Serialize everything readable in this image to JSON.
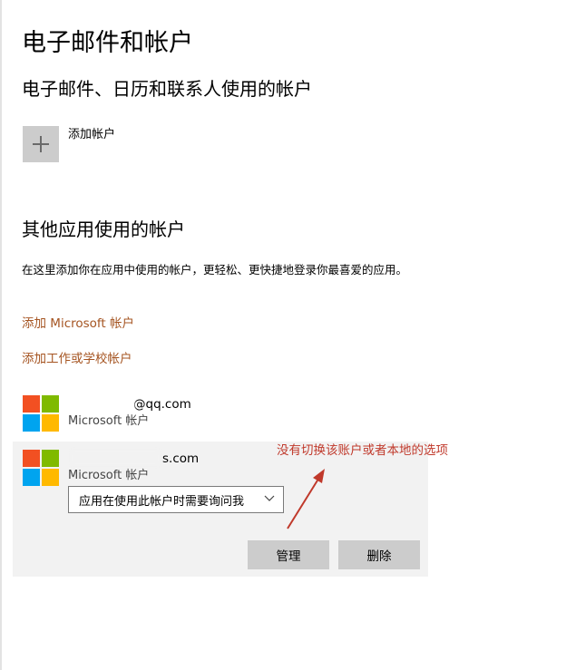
{
  "page": {
    "title": "电子邮件和帐户"
  },
  "email_section": {
    "title": "电子邮件、日历和联系人使用的帐户",
    "add_account_label": "添加帐户"
  },
  "other_apps_section": {
    "title": "其他应用使用的帐户",
    "description": "在这里添加你在应用中使用的帐户，更轻松、更快捷地登录你最喜爱的应用。",
    "add_microsoft_link": "添加 Microsoft 帐户",
    "add_work_link": "添加工作或学校帐户"
  },
  "accounts": [
    {
      "email_visible": "@qq.com",
      "type": "Microsoft 帐户"
    },
    {
      "email_visible": "s.com",
      "type": "Microsoft 帐户",
      "dropdown_value": "应用在使用此帐户时需要询问我",
      "manage_label": "管理",
      "delete_label": "删除"
    }
  ],
  "annotation": {
    "text": "没有切换该账户或者本地的选项",
    "color": "#c0392b"
  },
  "colors": {
    "ms_red": "#f25022",
    "ms_green": "#7fba00",
    "ms_blue": "#00a4ef",
    "ms_yellow": "#ffb900",
    "link": "#a55421",
    "button_bg": "#cccccc",
    "expanded_bg": "#f2f2f2"
  },
  "icons": {
    "add": "plus-icon",
    "account_logo": "microsoft-logo-icon",
    "dropdown": "chevron-down-icon"
  }
}
